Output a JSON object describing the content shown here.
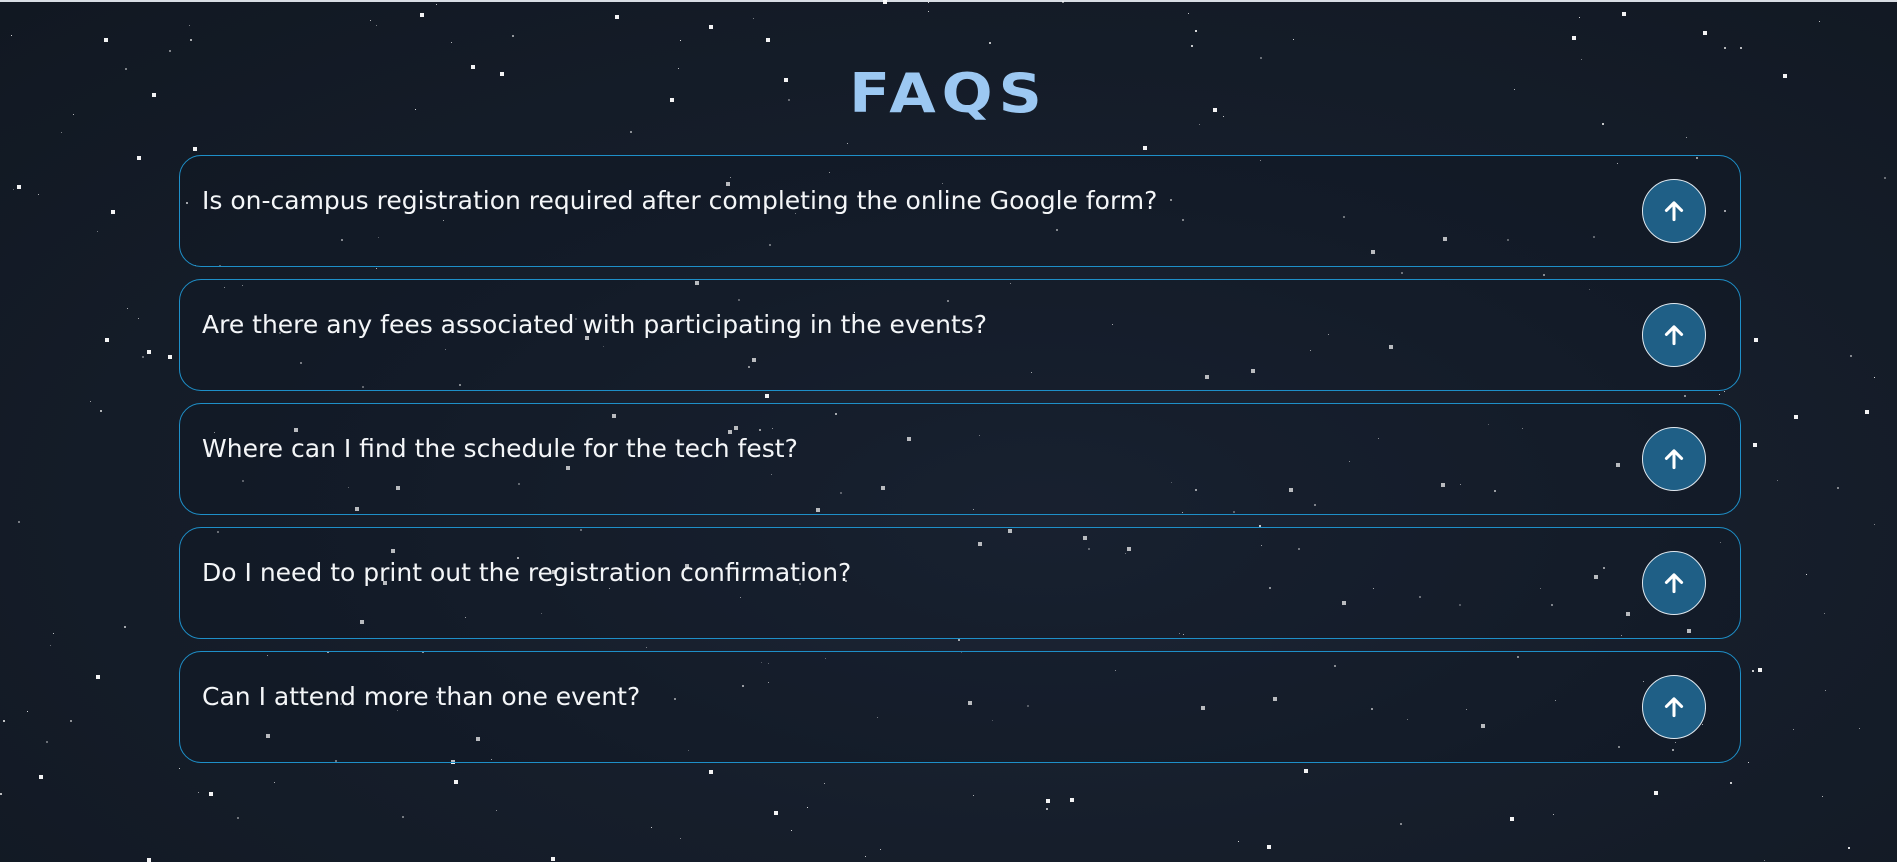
{
  "page": {
    "title": "FAQS"
  },
  "faqs": [
    {
      "question": "Is on-campus registration required after completing the online Google form?",
      "toggle_icon": "arrow-up-icon"
    },
    {
      "question": "Are there any fees associated with participating in the events?",
      "toggle_icon": "arrow-up-icon"
    },
    {
      "question": "Where can I find the schedule for the tech fest?",
      "toggle_icon": "arrow-up-icon"
    },
    {
      "question": "Do I need to print out the registration confirmation?",
      "toggle_icon": "arrow-up-icon"
    },
    {
      "question": "Can I attend more than one event?",
      "toggle_icon": "arrow-up-icon"
    }
  ],
  "colors": {
    "background": "#161e2b",
    "title": "#9cc8f2",
    "card_border": "#1e8fc8",
    "toggle_fill": "#1f5f86",
    "text": "#f4f6f8"
  }
}
